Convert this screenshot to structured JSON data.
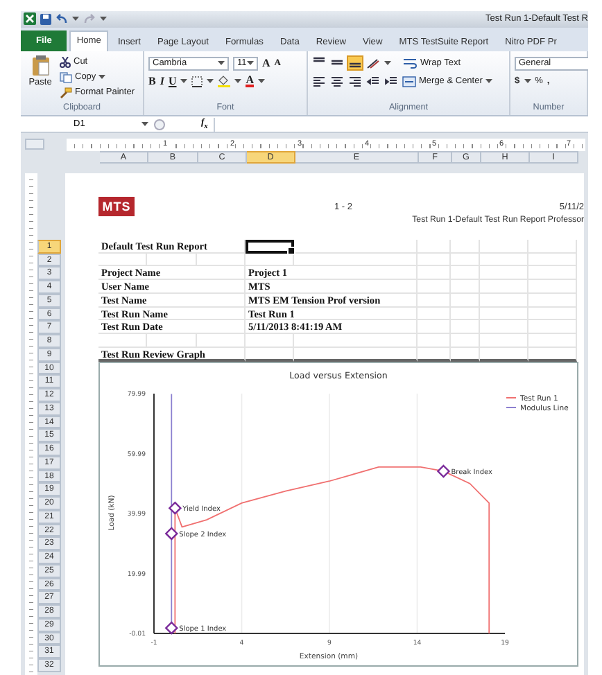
{
  "window": {
    "title": "Test Run 1-Default Test R"
  },
  "tabs": [
    {
      "label": "File",
      "kind": "file",
      "selected": false
    },
    {
      "label": "Home",
      "kind": "tab",
      "selected": true
    },
    {
      "label": "Insert",
      "kind": "tab",
      "selected": false
    },
    {
      "label": "Page Layout",
      "kind": "tab",
      "selected": false
    },
    {
      "label": "Formulas",
      "kind": "tab",
      "selected": false
    },
    {
      "label": "Data",
      "kind": "tab",
      "selected": false
    },
    {
      "label": "Review",
      "kind": "tab",
      "selected": false
    },
    {
      "label": "View",
      "kind": "tab",
      "selected": false
    },
    {
      "label": "MTS TestSuite Report",
      "kind": "tab",
      "selected": false
    },
    {
      "label": "Nitro PDF Pr",
      "kind": "tab",
      "selected": false
    }
  ],
  "ribbon": {
    "clipboard": {
      "label": "Clipboard",
      "paste": "Paste",
      "cut": "Cut",
      "copy": "Copy",
      "format_painter": "Format Painter"
    },
    "font": {
      "label": "Font",
      "name": "Cambria",
      "size": "11",
      "grow": "A",
      "shrink": "A",
      "styles": [
        "B",
        "I",
        "U"
      ],
      "font_color": "A"
    },
    "alignment": {
      "label": "Alignment",
      "vertical": [
        {
          "selected": false
        },
        {
          "selected": false
        },
        {
          "selected": true
        }
      ],
      "wrap_text": "Wrap Text",
      "merge": "Merge & Center"
    },
    "number": {
      "label": "Number",
      "format": "General",
      "currency": "$",
      "percent": "%",
      "comma": ","
    }
  },
  "formula_bar": {
    "name_box": "D1",
    "function_label": "f$_{x}$"
  },
  "ruler": [
    "1",
    "2",
    "3",
    "4",
    "5",
    "6",
    "7"
  ],
  "columns": [
    {
      "label": "A",
      "selected": false
    },
    {
      "label": "B",
      "selected": false
    },
    {
      "label": "C",
      "selected": false
    },
    {
      "label": "D",
      "selected": true
    },
    {
      "label": "E",
      "selected": false
    },
    {
      "label": "F",
      "selected": false
    },
    {
      "label": "G",
      "selected": false
    },
    {
      "label": "H",
      "selected": false
    },
    {
      "label": "I",
      "selected": false
    }
  ],
  "rows": [
    {
      "label": "1",
      "selected": true
    },
    {
      "label": "2",
      "selected": false
    },
    {
      "label": "3",
      "selected": false
    },
    {
      "label": "4",
      "selected": false
    },
    {
      "label": "5",
      "selected": false
    },
    {
      "label": "6",
      "selected": false
    },
    {
      "label": "7",
      "selected": false
    },
    {
      "label": "8",
      "selected": false
    },
    {
      "label": "9",
      "selected": false
    },
    {
      "label": "10",
      "selected": false
    },
    {
      "label": "11",
      "selected": false
    },
    {
      "label": "12",
      "selected": false
    },
    {
      "label": "13",
      "selected": false
    },
    {
      "label": "14",
      "selected": false
    },
    {
      "label": "15",
      "selected": false
    },
    {
      "label": "16",
      "selected": false
    },
    {
      "label": "17",
      "selected": false
    },
    {
      "label": "18",
      "selected": false
    },
    {
      "label": "19",
      "selected": false
    },
    {
      "label": "20",
      "selected": false
    },
    {
      "label": "21",
      "selected": false
    },
    {
      "label": "22",
      "selected": false
    },
    {
      "label": "23",
      "selected": false
    },
    {
      "label": "24",
      "selected": false
    },
    {
      "label": "25",
      "selected": false
    },
    {
      "label": "26",
      "selected": false
    },
    {
      "label": "27",
      "selected": false
    },
    {
      "label": "28",
      "selected": false
    },
    {
      "label": "29",
      "selected": false
    },
    {
      "label": "30",
      "selected": false
    },
    {
      "label": "31",
      "selected": false
    },
    {
      "label": "32",
      "selected": false
    }
  ],
  "page_header": {
    "logo": "MTS",
    "page_number": "1 - 2",
    "date": "5/11/2",
    "report_name": "Test Run 1-Default Test Run Report Professor"
  },
  "cells": {
    "title": "Default Test Run Report",
    "fields": [
      {
        "label": "Project Name",
        "value": "Project 1"
      },
      {
        "label": "User Name",
        "value": "MTS"
      },
      {
        "label": "Test Name",
        "value": "MTS EM Tension Prof version"
      },
      {
        "label": "Test Run Name",
        "value": "Test Run 1"
      },
      {
        "label": "Test Run Date",
        "value": "5/11/2013 8:41:19 AM"
      }
    ],
    "graph_title": "Test Run Review Graph"
  },
  "chart": {
    "chart_data": {
      "type": "line",
      "title": "Load versus Extension",
      "xlabel": "Extension (mm)",
      "ylabel": "Load (kN)",
      "xlim": [
        -1,
        19
      ],
      "ylim": [
        -0.01,
        79.99
      ],
      "xticks": [
        -1,
        4,
        9,
        14,
        19
      ],
      "yticks": [
        -0.01,
        19.99,
        39.99,
        59.99,
        79.99
      ],
      "series": [
        {
          "name": "Test Run 1",
          "color": "#f07070",
          "x": [
            0.2,
            0.2,
            0.6,
            2,
            4,
            6.5,
            9,
            11.8,
            14.2,
            15.5,
            17,
            18.1,
            18.1
          ],
          "values": [
            0,
            41.8,
            35.5,
            37.9,
            43.5,
            47.5,
            50.8,
            55.5,
            55.5,
            54.1,
            50,
            43.5,
            0
          ]
        },
        {
          "name": "Modulus Line",
          "color": "#8c80d0",
          "x": [
            0,
            0
          ],
          "values": [
            0,
            79.9
          ]
        }
      ],
      "grid": true,
      "legend": "top-right",
      "annotations": [
        {
          "text": "Yield Index",
          "x": 0.2,
          "y": 41.8
        },
        {
          "text": "Slope 2 Index",
          "x": 0,
          "y": 33.3
        },
        {
          "text": "Break Index",
          "x": 15.5,
          "y": 54.1
        },
        {
          "text": "Slope 1 Index",
          "x": 0,
          "y": 1.8
        }
      ]
    }
  }
}
